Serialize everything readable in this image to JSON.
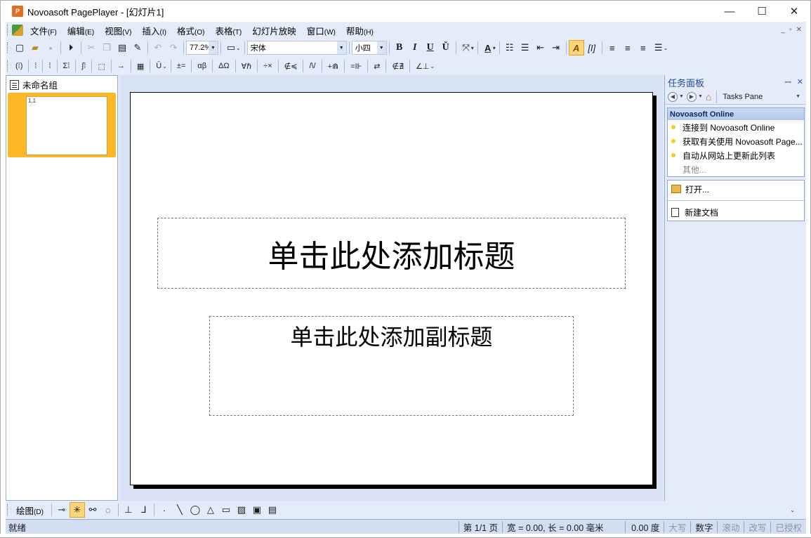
{
  "window": {
    "app_icon_label": "P",
    "title": "Novoasoft PagePlayer - [幻灯片1]",
    "minimize": "—",
    "maximize": "☐",
    "close": "✕"
  },
  "menubar": {
    "items": [
      {
        "label": "文件",
        "key": "(F)"
      },
      {
        "label": "编辑",
        "key": "(E)"
      },
      {
        "label": "视图",
        "key": "(V)"
      },
      {
        "label": "插入",
        "key": "(I)"
      },
      {
        "label": "格式",
        "key": "(O)"
      },
      {
        "label": "表格",
        "key": "(T)"
      },
      {
        "label": "幻灯片放映",
        "key": ""
      },
      {
        "label": "窗口",
        "key": "(W)"
      },
      {
        "label": "帮助",
        "key": "(H)"
      }
    ],
    "mdi": [
      "_",
      "▫",
      "✕"
    ]
  },
  "toolbar1": {
    "zoom": "77.2%",
    "font": "宋体",
    "size": "小四",
    "bold": "B",
    "italic": "I",
    "underline": "U",
    "strike": "Ŭ"
  },
  "toolbar2": {
    "items": [
      "(⁞)",
      "⁞",
      "⁞",
      "Σ⁞",
      "∫⁞",
      "⬚",
      "→",
      "▦",
      "Ū",
      "±=",
      "αβ",
      "ΔΩ",
      "∀ℏ",
      "÷×",
      "∉≼",
      "/\\/",
      "+⋒",
      "=⊪",
      "⇄",
      "∉∄",
      "∠⊥"
    ]
  },
  "left_panel": {
    "group_title": "未命名组",
    "slide_number": "1.1"
  },
  "slide": {
    "title_placeholder": "单击此处添加标题",
    "subtitle_placeholder": "单击此处添加副标题"
  },
  "task_pane": {
    "title": "任务面板",
    "pin": "ꟷ",
    "close": "✕",
    "nav_label": "Tasks Pane",
    "online_section": {
      "title": "Novoasoft Online",
      "links": [
        "连接到 Novoasoft Online",
        "获取有关使用 Novoasoft Page...",
        "自动从网站上更新此列表"
      ],
      "more": "其他..."
    },
    "open_label": "打开...",
    "new_doc_label": "新建文档"
  },
  "drawbar": {
    "label": "绘图",
    "key": "(D)"
  },
  "statusbar": {
    "ready": "就绪",
    "page": "第 1/1 页",
    "dims": "宽 =   0.00, 长 =   0.00 毫米",
    "angle": "0.00 度",
    "caps": "大写",
    "num": "数字",
    "scroll": "滚动",
    "overwrite": "改写",
    "licensed": "已授权"
  }
}
